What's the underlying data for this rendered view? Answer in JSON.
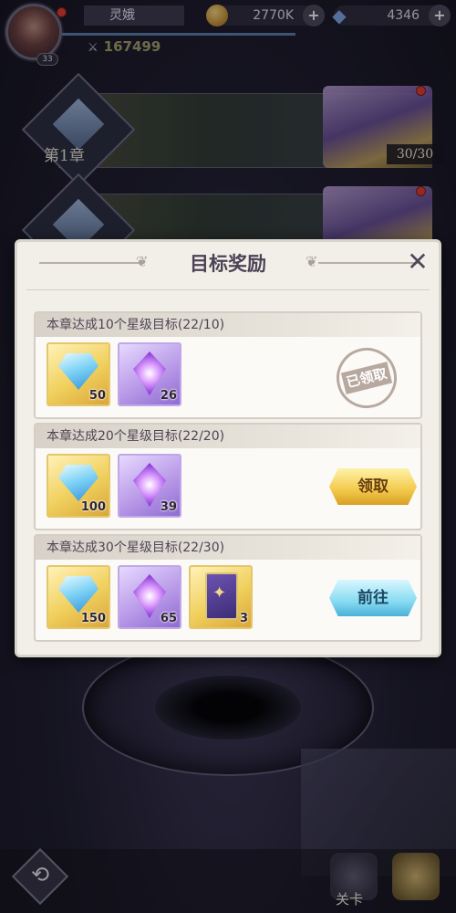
{
  "topbar": {
    "avatar_level": "33",
    "player_name": "灵娥",
    "combat_power": "167499",
    "gold": "2770K",
    "gems": "4346",
    "plus_symbol": "+"
  },
  "chapters": [
    {
      "title": "第1章",
      "stars": "30/30"
    },
    {
      "title": "",
      "stars": ""
    }
  ],
  "modal": {
    "title": "目标奖励",
    "close_symbol": "✕",
    "rows": [
      {
        "header": "本章达成10个星级目标(22/10)",
        "items": [
          {
            "type": "diamond-icon",
            "qty": "50"
          },
          {
            "type": "crystal-icon",
            "qty": "26"
          }
        ],
        "status": "已领取"
      },
      {
        "header": "本章达成20个星级目标(22/20)",
        "items": [
          {
            "type": "diamond-icon",
            "qty": "100"
          },
          {
            "type": "crystal-icon",
            "qty": "39"
          }
        ],
        "button": "领取"
      },
      {
        "header": "本章达成30个星级目标(22/30)",
        "items": [
          {
            "type": "diamond-icon",
            "qty": "150"
          },
          {
            "type": "crystal-icon",
            "qty": "65"
          },
          {
            "type": "card-icon",
            "qty": "3"
          }
        ],
        "button": "前往"
      }
    ]
  },
  "bottom_nav": {
    "back_symbol": "⟲",
    "stage_label": "关卡",
    "active_label": ""
  },
  "colors": {
    "claim_button": "#f2c94a",
    "goto_button": "#86dbf2",
    "red_dot": "#e23b2e"
  }
}
